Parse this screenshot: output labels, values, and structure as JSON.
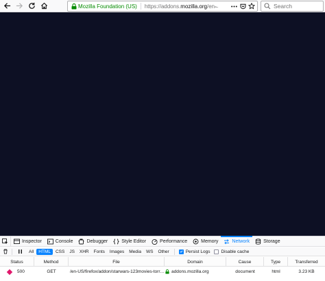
{
  "browser": {
    "identity": "Mozilla Foundation (US)",
    "url_scheme": "https://",
    "url_host_prefix": "addons.",
    "url_host_main": "mozilla.org",
    "url_path": "/en-̶",
    "search_placeholder": "Search"
  },
  "devtools": {
    "tabs": [
      {
        "label": "Inspector",
        "icon": "inspector-icon"
      },
      {
        "label": "Console",
        "icon": "console-icon"
      },
      {
        "label": "Debugger",
        "icon": "debugger-icon"
      },
      {
        "label": "Style Editor",
        "icon": "style-editor-icon"
      },
      {
        "label": "Performance",
        "icon": "performance-icon"
      },
      {
        "label": "Memory",
        "icon": "memory-icon"
      },
      {
        "label": "Network",
        "icon": "network-icon",
        "selected": true
      },
      {
        "label": "Storage",
        "icon": "storage-icon"
      }
    ],
    "filters": [
      "All",
      "HTML",
      "CSS",
      "JS",
      "XHR",
      "Fonts",
      "Images",
      "Media",
      "WS",
      "Other"
    ],
    "filter_selected": "HTML",
    "persist_logs": "Persist Logs",
    "persist_logs_checked": true,
    "disable_cache": "Disable cache",
    "disable_cache_checked": false,
    "columns": [
      "Status",
      "Method",
      "File",
      "Domain",
      "Cause",
      "Type",
      "Transferred"
    ],
    "rows": [
      {
        "status": "500",
        "method": "GET",
        "file": "/en-US/firefox/addon/starwars-123movies-torr…",
        "domain": "addons.mozilla.org",
        "cause": "document",
        "type": "html",
        "transferred": "3.23 KB"
      }
    ]
  },
  "colors": {
    "content_background": "#0d1024",
    "accent": "#0a84ff",
    "secure_identity": "#058b00",
    "status_error": "#e0186c"
  }
}
